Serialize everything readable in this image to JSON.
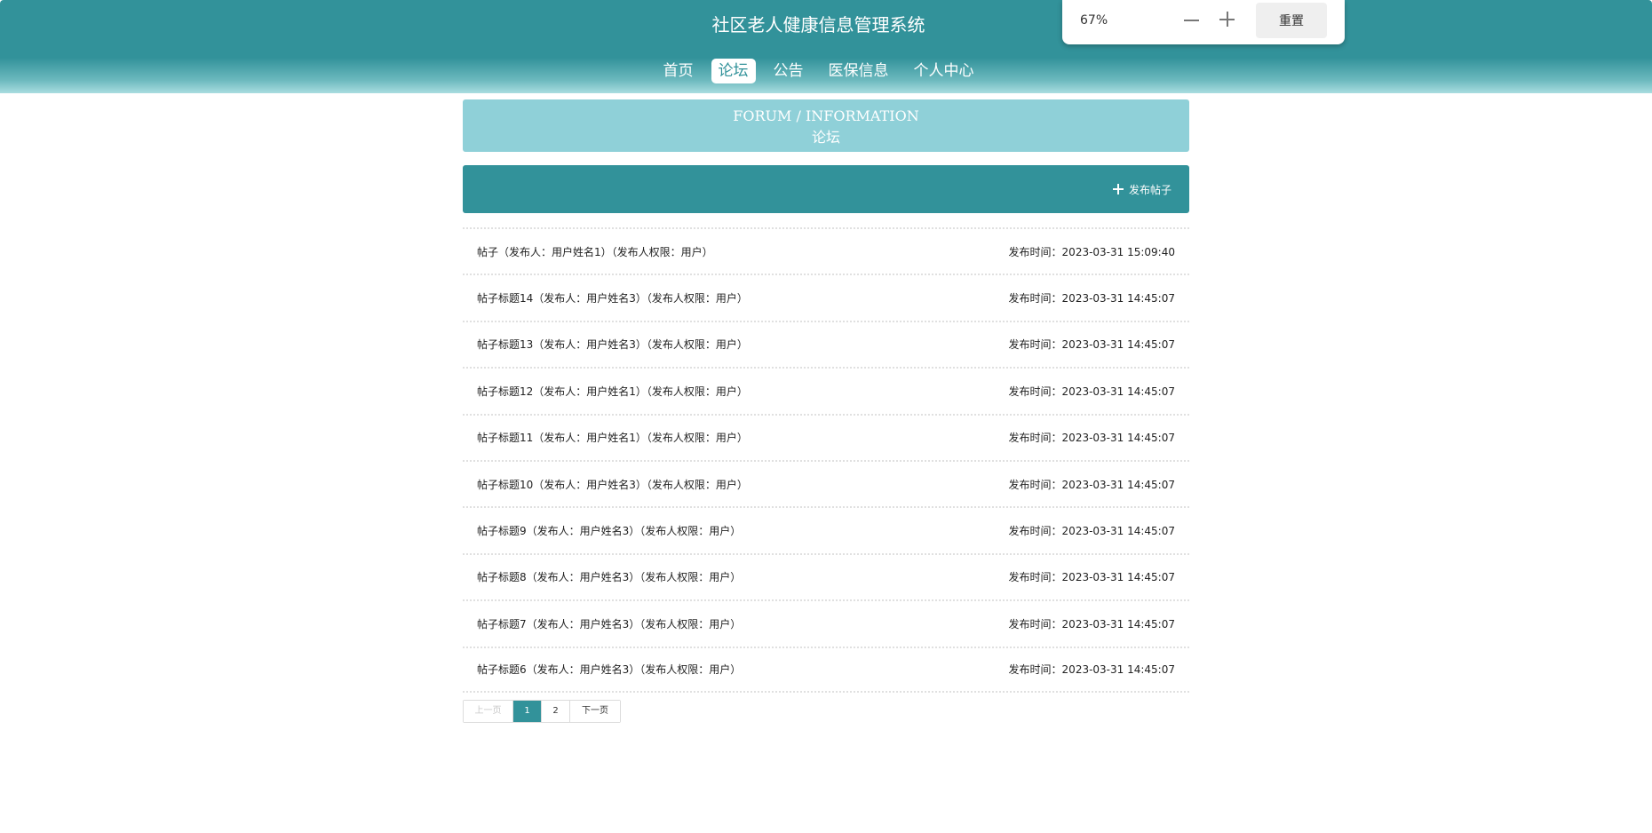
{
  "header": {
    "title": "社区老人健康信息管理系统",
    "nav": [
      {
        "label": "首页",
        "active": false
      },
      {
        "label": "论坛",
        "active": true
      },
      {
        "label": "公告",
        "active": false
      },
      {
        "label": "医保信息",
        "active": false
      },
      {
        "label": "个人中心",
        "active": false
      }
    ]
  },
  "zoom": {
    "level": "67%",
    "minus_icon": "minus-icon",
    "plus_icon": "plus-icon",
    "reset_label": "重置"
  },
  "banner": {
    "en": "FORUM / INFORMATION",
    "cn": "论坛"
  },
  "toolbar": {
    "post_label": "发布帖子",
    "post_icon": "plus-icon"
  },
  "posts": [
    {
      "title": "帖子（发布人：用户姓名1）（发布人权限：用户）",
      "time": "发布时间：2023-03-31 15:09:40"
    },
    {
      "title": "帖子标题14（发布人：用户姓名3）（发布人权限：用户）",
      "time": "发布时间：2023-03-31 14:45:07"
    },
    {
      "title": "帖子标题13（发布人：用户姓名3）（发布人权限：用户）",
      "time": "发布时间：2023-03-31 14:45:07"
    },
    {
      "title": "帖子标题12（发布人：用户姓名1）（发布人权限：用户）",
      "time": "发布时间：2023-03-31 14:45:07"
    },
    {
      "title": "帖子标题11（发布人：用户姓名1）（发布人权限：用户）",
      "time": "发布时间：2023-03-31 14:45:07"
    },
    {
      "title": "帖子标题10（发布人：用户姓名3）（发布人权限：用户）",
      "time": "发布时间：2023-03-31 14:45:07"
    },
    {
      "title": "帖子标题9（发布人：用户姓名3）（发布人权限：用户）",
      "time": "发布时间：2023-03-31 14:45:07"
    },
    {
      "title": "帖子标题8（发布人：用户姓名3）（发布人权限：用户）",
      "time": "发布时间：2023-03-31 14:45:07"
    },
    {
      "title": "帖子标题7（发布人：用户姓名3）（发布人权限：用户）",
      "time": "发布时间：2023-03-31 14:45:07"
    },
    {
      "title": "帖子标题6（发布人：用户姓名3）（发布人权限：用户）",
      "time": "发布时间：2023-03-31 14:45:07"
    }
  ],
  "pagination": {
    "prev": "上一页",
    "pages": [
      "1",
      "2"
    ],
    "current": "1",
    "next": "下一页"
  },
  "colors": {
    "primary": "#32929a",
    "banner": "#8fd0d8"
  }
}
